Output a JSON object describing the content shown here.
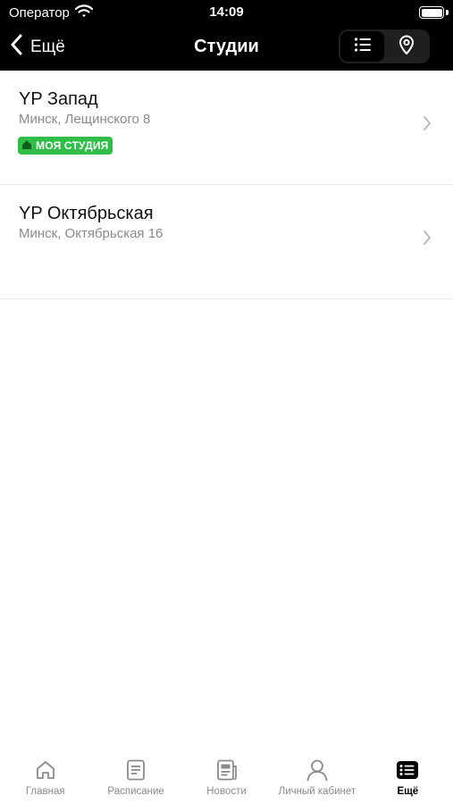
{
  "status_bar": {
    "carrier": "Оператор",
    "time": "14:09"
  },
  "nav": {
    "back_label": "Ещё",
    "title": "Студии",
    "view_toggle": {
      "selected": "list",
      "options": [
        "list-icon",
        "map-pin-icon"
      ]
    }
  },
  "studios": [
    {
      "name": "YP Запад",
      "address": "Минск, Лещинского 8",
      "badge": "МОЯ СТУДИЯ"
    },
    {
      "name": "YP Октябрьская",
      "address": "Минск, Октябрьская 16"
    }
  ],
  "tab_bar": {
    "active": "more",
    "tabs": [
      {
        "label": "Главная",
        "icon": "home-icon"
      },
      {
        "label": "Расписание",
        "icon": "schedule-icon"
      },
      {
        "label": "Новости",
        "icon": "news-icon"
      },
      {
        "label": "Личный кабинет",
        "icon": "profile-icon"
      },
      {
        "label": "Ещё",
        "icon": "more-icon"
      }
    ]
  },
  "colors": {
    "header_background": "#000000",
    "badge_green": "#2fbe47",
    "secondary_text": "#8a8a8a"
  }
}
